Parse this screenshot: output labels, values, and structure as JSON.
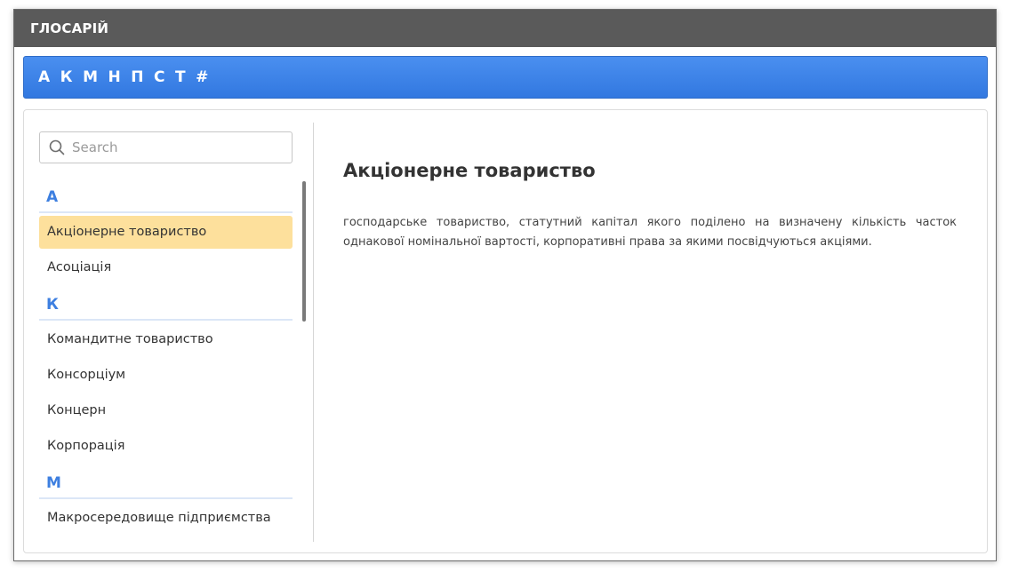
{
  "window": {
    "title": "ГЛОСАРІЙ"
  },
  "alphabet": [
    "А",
    "К",
    "М",
    "Н",
    "П",
    "С",
    "Т",
    "#"
  ],
  "search": {
    "placeholder": "Search",
    "value": ""
  },
  "groups": [
    {
      "letter": "А",
      "items": [
        "Акціонерне товариство",
        "Асоціація"
      ]
    },
    {
      "letter": "К",
      "items": [
        "Командитне товариство",
        "Консорціум",
        "Концерн",
        "Корпорація"
      ]
    },
    {
      "letter": "М",
      "items": [
        "Макросередовище підприємства"
      ]
    }
  ],
  "selected": "Акціонерне товариство",
  "definition": {
    "title": "Акціонерне товариство",
    "text": "господарське товариство, статутний капітал якого поділено на визначену кількість часток однакової номінальної вартості, корпоративні права за якими посвідчуються акціями."
  },
  "colors": {
    "titlebar": "#5a5a5a",
    "alphabar": "#3278e0",
    "group_letter": "#3d7fe0",
    "selected_item": "#fde09c"
  },
  "icons": {
    "search": "search-icon"
  }
}
